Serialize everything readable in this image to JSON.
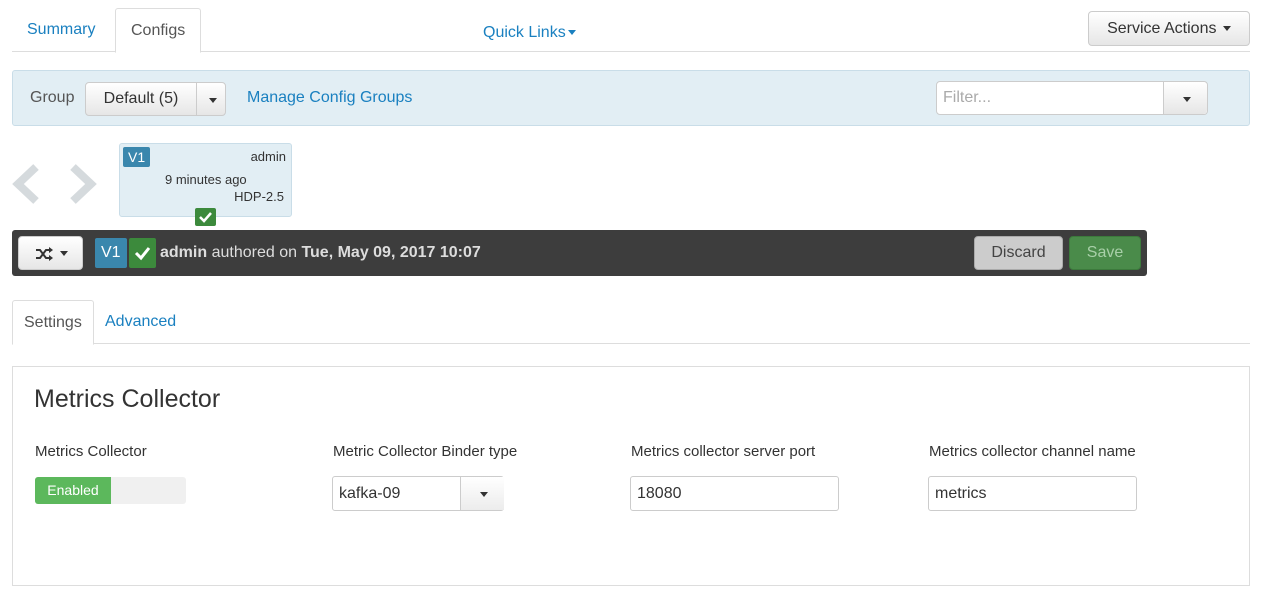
{
  "top_tabs": [
    {
      "label": "Summary",
      "active": false
    },
    {
      "label": "Configs",
      "active": true
    }
  ],
  "quick_links": "Quick Links",
  "service_actions": "Service Actions",
  "group_bar": {
    "group_label": "Group",
    "group_value": "Default (5)",
    "manage_link": "Manage Config Groups",
    "filter_placeholder": "Filter..."
  },
  "version_box": {
    "version": "V1",
    "author": "admin",
    "ago": "9 minutes ago",
    "stack": "HDP-2.5"
  },
  "current_version": {
    "version": "V1",
    "author": "admin",
    "authored_text": "authored on",
    "date": "Tue, May 09, 2017 10:07",
    "discard_label": "Discard",
    "save_label": "Save"
  },
  "sub_tabs": [
    {
      "label": "Settings",
      "active": true
    },
    {
      "label": "Advanced",
      "active": false
    }
  ],
  "panel": {
    "title": "Metrics Collector",
    "fields": [
      {
        "label": "Metrics Collector",
        "type": "toggle",
        "value": "Enabled"
      },
      {
        "label": "Metric Collector Binder type",
        "type": "select",
        "value": "kafka-09"
      },
      {
        "label": "Metrics collector server port",
        "type": "text",
        "value": "18080"
      },
      {
        "label": "Metrics collector channel name",
        "type": "text",
        "value": "metrics"
      }
    ]
  },
  "colors": {
    "link": "#1a80c0",
    "info_bg": "#e2eef4",
    "dark_bar": "#3d3d3d",
    "success": "#5cb85c",
    "badge": "#3a87ad"
  }
}
